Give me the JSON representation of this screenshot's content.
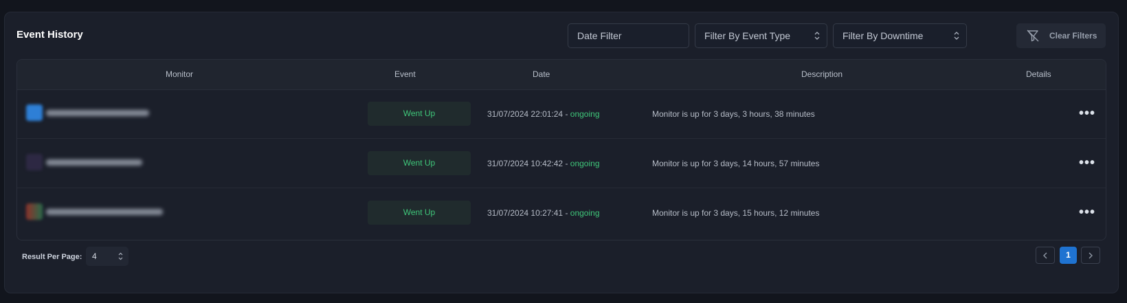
{
  "panel": {
    "title": "Event History"
  },
  "filters": {
    "date_placeholder": "Date Filter",
    "event_type": "Filter By Event Type",
    "downtime": "Filter By Downtime",
    "clear_label": "Clear Filters"
  },
  "table": {
    "headers": {
      "monitor": "Monitor",
      "event": "Event",
      "date": "Date",
      "description": "Description",
      "details": "Details"
    },
    "rows": [
      {
        "event": "Went Up",
        "date": "31/07/2024 22:01:24",
        "separator": " - ",
        "status": "ongoing",
        "description": "Monitor is up for 3 days, 3 hours, 38 minutes",
        "details_icon": "more-horizontal-icon"
      },
      {
        "event": "Went Up",
        "date": "31/07/2024 10:42:42",
        "separator": " - ",
        "status": "ongoing",
        "description": "Monitor is up for 3 days, 14 hours, 57 minutes",
        "details_icon": "more-horizontal-icon"
      },
      {
        "event": "Went Up",
        "date": "31/07/2024 10:27:41",
        "separator": " - ",
        "status": "ongoing",
        "description": "Monitor is up for 3 days, 15 hours, 12 minutes",
        "details_icon": "more-horizontal-icon"
      }
    ]
  },
  "footer": {
    "result_per_page_label": "Result Per Page:",
    "result_per_page_value": "4",
    "current_page": "1"
  },
  "colors": {
    "accent": "#1f73d1",
    "success": "#3fc77a",
    "panel": "#1b1f2a",
    "background": "#12151d"
  }
}
